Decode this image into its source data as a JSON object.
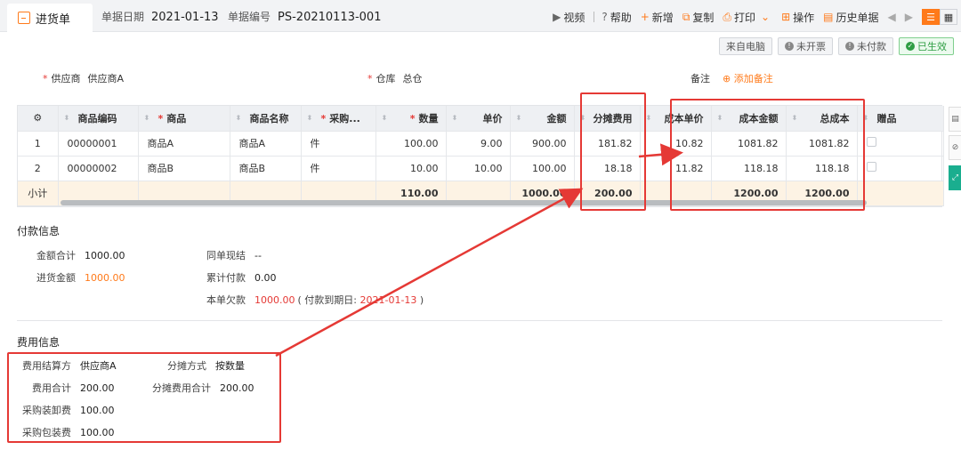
{
  "tab": {
    "title": "进货单"
  },
  "doc": {
    "date_label": "单据日期",
    "date": "2021-01-13",
    "no_label": "单据编号",
    "no": "PS-20210113-001"
  },
  "toolbar": {
    "video": "视频",
    "help": "帮助",
    "add": "新增",
    "copy": "复制",
    "print": "打印",
    "operate": "操作",
    "history": "历史单据"
  },
  "badges": {
    "source": "来自电脑",
    "invoice": "未开票",
    "payment": "未付款",
    "status": "已生效"
  },
  "header": {
    "supplier_label": "供应商",
    "supplier": "供应商A",
    "warehouse_label": "仓库",
    "warehouse": "总仓",
    "note_label": "备注",
    "add_note": "添加备注"
  },
  "grid": {
    "columns": [
      "",
      "商品编码",
      "商品",
      "商品名称",
      "采购...",
      "数量",
      "单价",
      "金额",
      "分摊费用",
      "成本单价",
      "成本金额",
      "总成本",
      "赠品"
    ],
    "required": [
      false,
      false,
      true,
      false,
      true,
      true,
      false,
      false,
      false,
      false,
      false,
      false,
      false
    ],
    "rows": [
      [
        "1",
        "00000001",
        "商品A",
        "商品A",
        "件",
        "100.00",
        "9.00",
        "900.00",
        "181.82",
        "10.82",
        "1081.82",
        "1081.82",
        ""
      ],
      [
        "2",
        "00000002",
        "商品B",
        "商品B",
        "件",
        "10.00",
        "10.00",
        "100.00",
        "18.18",
        "11.82",
        "118.18",
        "118.18",
        ""
      ]
    ],
    "subtotal": [
      "小计",
      "",
      "",
      "",
      "",
      "110.00",
      "",
      "1000.00",
      "200.00",
      "",
      "1200.00",
      "1200.00",
      ""
    ]
  },
  "payment": {
    "title": "付款信息",
    "total_label": "金额合计",
    "total": "1000.00",
    "purchase_label": "进货金额",
    "purchase": "1000.00",
    "settle_label": "同单现结",
    "settle": "--",
    "cum_label": "累计付款",
    "cum": "0.00",
    "owed_label": "本单欠款",
    "owed": "1000.00",
    "due_prefix": "( 付款到期日: ",
    "due": "2021-01-13",
    "due_suffix": " )"
  },
  "fees": {
    "title": "费用信息",
    "settle_label": "费用结算方",
    "settle": "供应商A",
    "method_label": "分摊方式",
    "method": "按数量",
    "total_label": "费用合计",
    "total": "200.00",
    "alloc_label": "分摊费用合计",
    "alloc": "200.00",
    "loading_label": "采购装卸费",
    "loading": "100.00",
    "packing_label": "采购包装费",
    "packing": "100.00"
  },
  "colors": {
    "accent": "#ff7a1a",
    "annotation": "#e53935",
    "active": "#2f9e44"
  }
}
